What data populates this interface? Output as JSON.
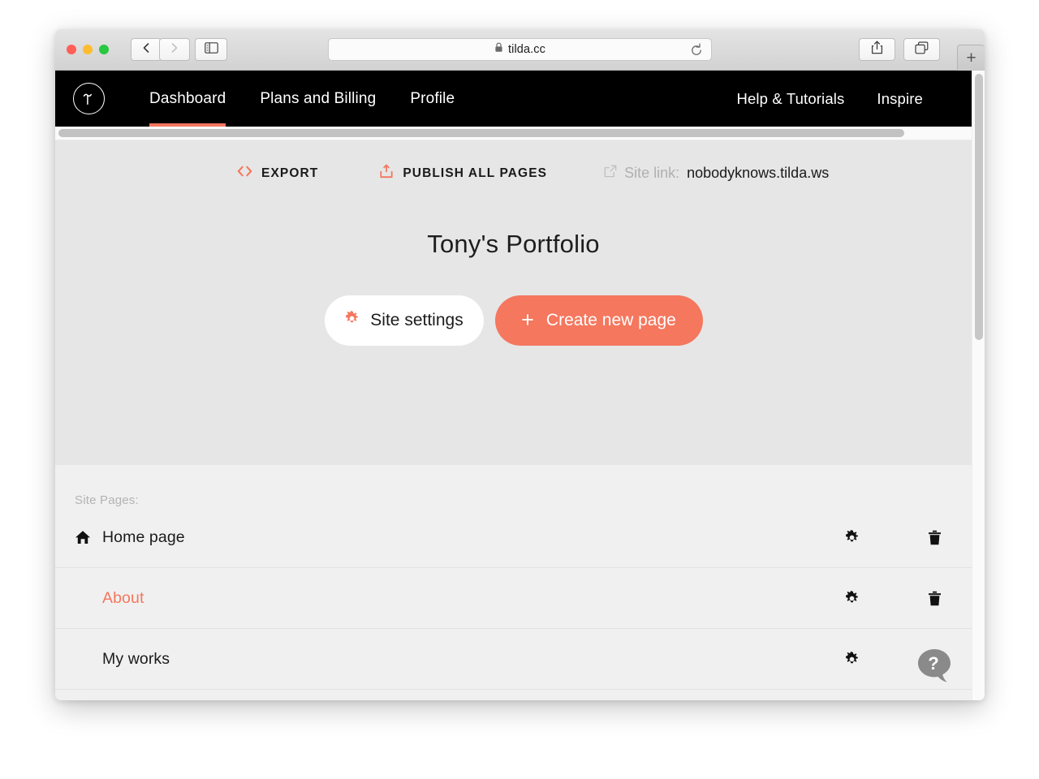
{
  "browser": {
    "url": "tilda.cc",
    "lock_icon": "lock-icon",
    "back_icon": "chevron-left-icon",
    "forward_icon": "chevron-right-icon",
    "sidebar_icon": "sidebar-toggle-icon",
    "reload_icon": "reload-icon",
    "share_icon": "share-icon",
    "tabs_icon": "show-tabs-icon",
    "new_tab_label": "+"
  },
  "topnav": {
    "logo_name": "tilda-logo",
    "left_items": [
      {
        "label": "Dashboard",
        "active": true
      },
      {
        "label": "Plans and Billing",
        "active": false
      },
      {
        "label": "Profile",
        "active": false
      }
    ],
    "right_items": [
      {
        "label": "Help & Tutorials"
      },
      {
        "label": "Inspire"
      }
    ],
    "active_underline_color": "#f4775e"
  },
  "hero": {
    "export_label": "EXPORT",
    "export_icon": "code-brackets-icon",
    "publish_label": "PUBLISH ALL PAGES",
    "publish_icon": "upload-icon",
    "site_link_icon": "external-link-icon",
    "site_link_label": "Site link:",
    "site_link_value": "nobodyknows.tilda.ws",
    "title": "Tony's Portfolio",
    "site_settings_label": "Site settings",
    "site_settings_icon": "gear-icon",
    "create_page_label": "Create new page",
    "create_page_plus": "+",
    "accent_color": "#f4775e",
    "background": "#e6e6e6"
  },
  "pages": {
    "section_label": "Site Pages:",
    "gear_icon": "gear-icon",
    "trash_icon": "trash-icon",
    "rows": [
      {
        "label": "Home page",
        "icon": "home-icon",
        "accent": false
      },
      {
        "label": "About",
        "icon": "",
        "accent": true
      },
      {
        "label": "My works",
        "icon": "",
        "accent": false
      }
    ]
  },
  "help": {
    "icon": "help-bubble-icon",
    "glyph": "?"
  }
}
